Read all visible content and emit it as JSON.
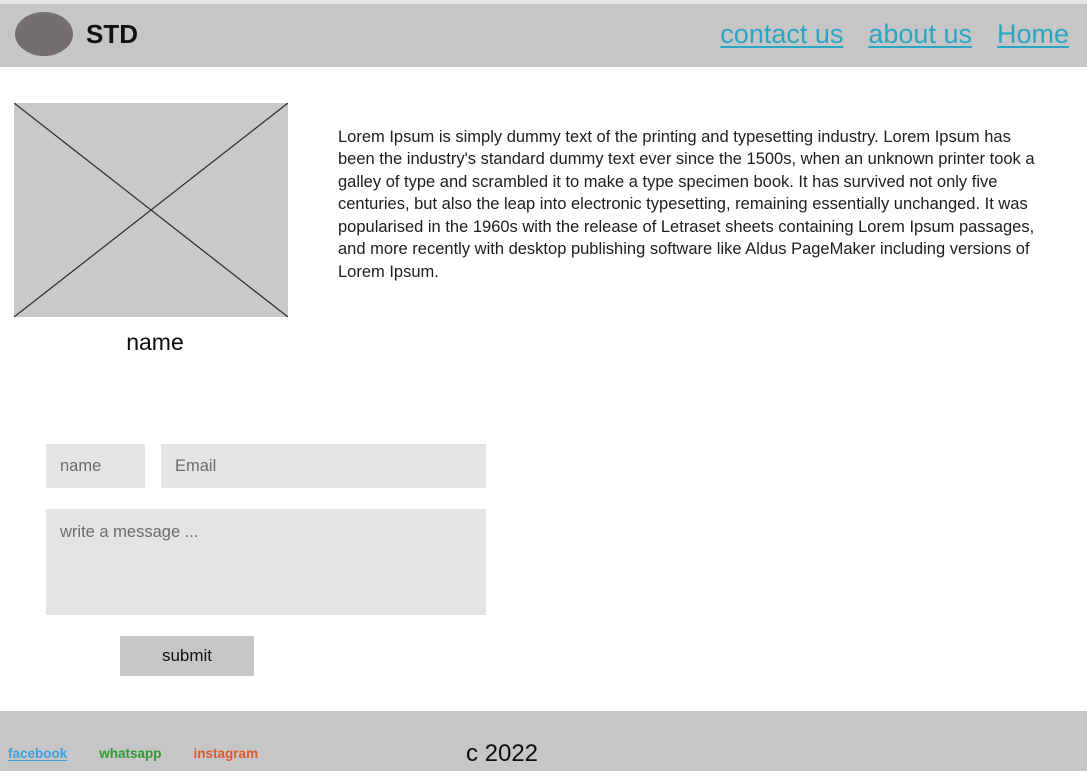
{
  "header": {
    "logo_icon": "ellipse-logo-icon",
    "brand": "STD",
    "nav": [
      {
        "label": "contact us",
        "color": "#2ba6c4"
      },
      {
        "label": "about us",
        "color": "#2ba6c4"
      },
      {
        "label": "Home",
        "color": "#2ba6c4"
      }
    ]
  },
  "hero": {
    "image_placeholder_icon": "image-placeholder-cross-icon",
    "caption": "name",
    "paragraph": "Lorem Ipsum is simply dummy text of the printing and typesetting industry. Lorem Ipsum has been the industry's standard dummy text ever since the 1500s, when an unknown printer took a galley of type and scrambled it to make a type specimen book. It has survived not only five centuries, but also the leap into electronic typesetting, remaining essentially unchanged. It was popularised in the 1960s with the release of Letraset sheets containing Lorem Ipsum passages, and more recently with desktop publishing software like Aldus PageMaker including versions of Lorem Ipsum."
  },
  "form": {
    "name_value": "",
    "name_placeholder": "name",
    "email_value": "",
    "email_placeholder": "Email",
    "message_value": "",
    "message_placeholder": "write a message ...",
    "submit_label": "submit"
  },
  "footer": {
    "social": [
      {
        "label": "facebook",
        "color": "#3f9fd8"
      },
      {
        "label": "whatsapp",
        "color": "#2d9b2d"
      },
      {
        "label": "instagram",
        "color": "#e2572a"
      }
    ],
    "copyright": "c 2022"
  },
  "colors": {
    "bar_gray": "#c6c6c6",
    "field_gray": "#e4e4e4",
    "placeholder_gray": "#c9c9c9",
    "logo_gray": "#736f6f",
    "nav_link": "#2ba6c4"
  }
}
